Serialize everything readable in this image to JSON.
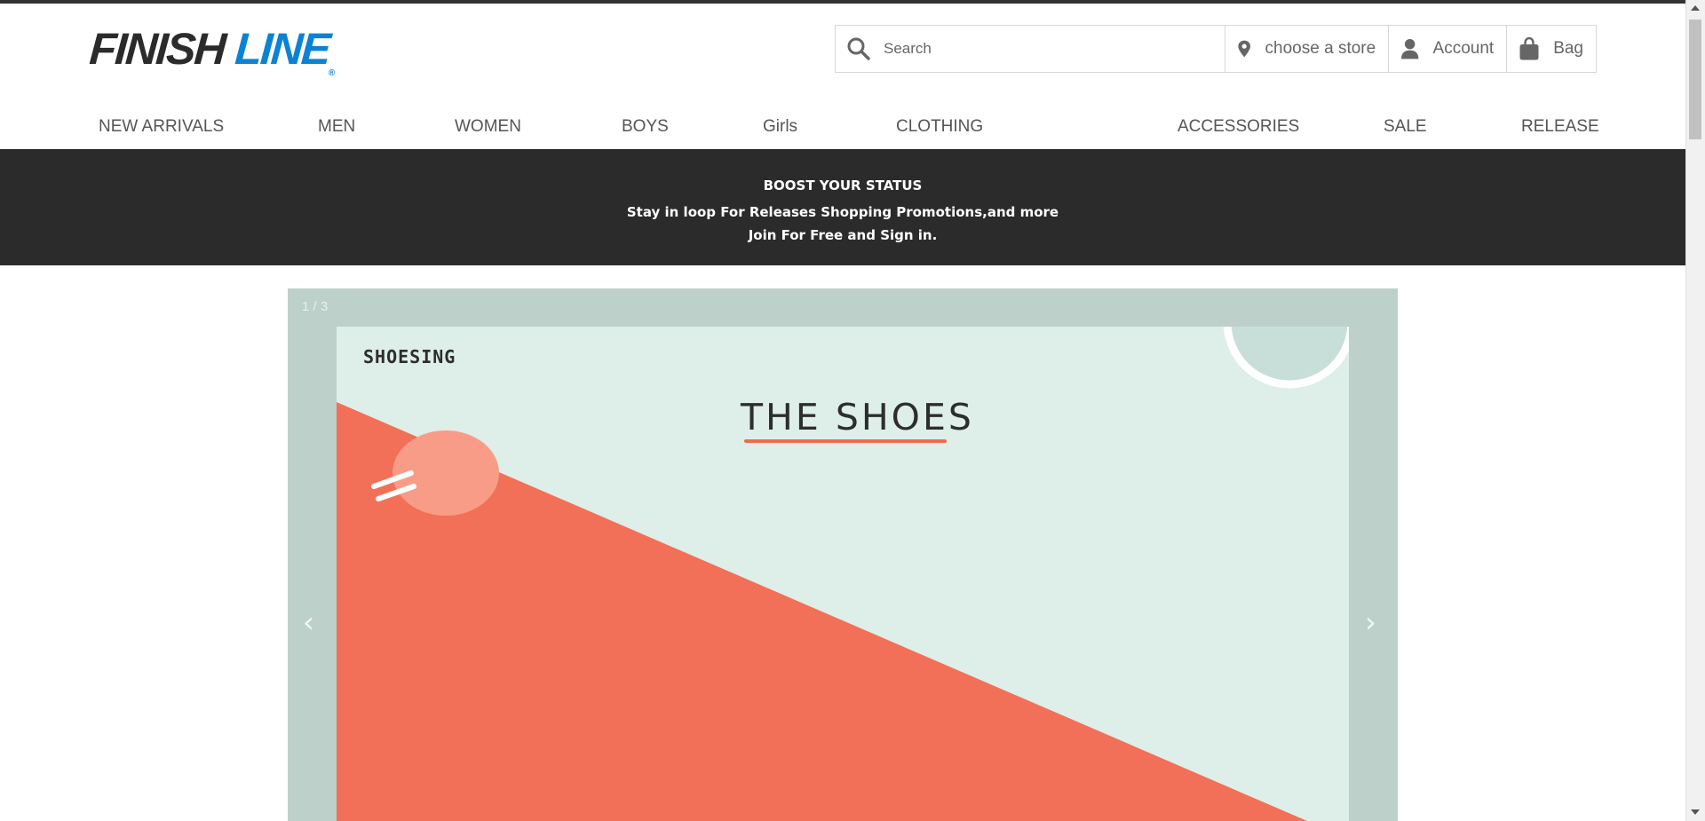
{
  "header": {
    "logo": {
      "part1": "FINISH",
      "part2": "LINE",
      "mark": "®"
    },
    "search": {
      "placeholder": "Search",
      "icon": "search-icon"
    },
    "store": {
      "label": "choose a store",
      "icon": "location-pin-icon"
    },
    "account": {
      "label": "Account",
      "icon": "user-icon"
    },
    "bag": {
      "label": "Bag",
      "icon": "shopping-bag-icon"
    }
  },
  "nav": {
    "items": [
      {
        "label": "NEW ARRIVALS"
      },
      {
        "label": "MEN"
      },
      {
        "label": "WOMEN"
      },
      {
        "label": "BOYS"
      },
      {
        "label": "Girls"
      },
      {
        "label": "CLOTHING"
      },
      {
        "label": "ACCESSORIES"
      },
      {
        "label": "SALE"
      },
      {
        "label": "RELEASE"
      }
    ]
  },
  "promo": {
    "title": "BOOST YOUR STATUS",
    "line1": "Stay in loop For Releases Shopping Promotions,and more",
    "line2": "Join For Free and Sign in."
  },
  "carousel": {
    "counter": "1 / 3",
    "prev": "‹",
    "next": "›",
    "slide": {
      "brand": "SHOESING",
      "headline": "THE SHOES"
    }
  },
  "colors": {
    "brand_dark": "#2b2b2b",
    "brand_blue": "#0b83d4",
    "promo_bg": "#2b2b2b",
    "slide_accent": "#f06b50",
    "slide_bg": "#deeee9",
    "carousel_bg": "#bdd0ca"
  }
}
